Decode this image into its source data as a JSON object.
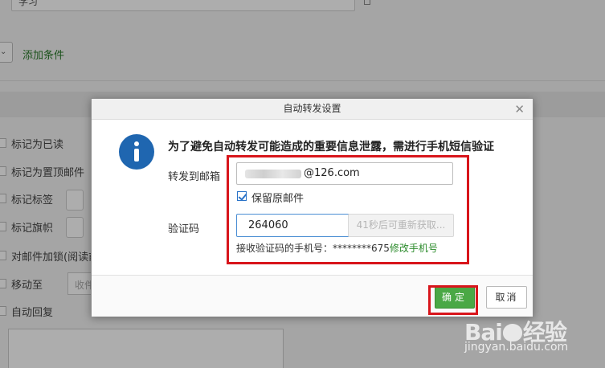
{
  "background": {
    "top_input_value": "学习",
    "add_condition": "添加条件",
    "actions": [
      {
        "label": "标记为已读"
      },
      {
        "label": "标记为置顶邮件"
      },
      {
        "label": "标记标签"
      },
      {
        "label": "标记旗帜"
      },
      {
        "label": "对邮件加锁(阅读前"
      },
      {
        "label": "移动至"
      },
      {
        "label": "自动回复"
      }
    ],
    "move_to_placeholder": "收件箱"
  },
  "dialog": {
    "title": "自动转发设置",
    "close_glyph": "✕",
    "notice": "为了避免自动转发可能造成的重要信息泄露，需进行手机短信验证",
    "forward_label": "转发到邮箱",
    "email_value": "@126.com",
    "keep_original_label": "保留原邮件",
    "keep_original_checked": true,
    "code_label": "验证码",
    "code_value": "264060",
    "resend_label": "41秒后可重新获取...",
    "phone_prefix": "接收验证码的手机号：********675",
    "change_phone_link": "修改手机号",
    "ok_label": "确定",
    "cancel_label": "取消"
  },
  "watermark": {
    "logo_left": "Bai",
    "logo_right": "经验",
    "url": "jingyan.baidu.com"
  },
  "colors": {
    "accent_green": "#4aa845",
    "info_blue": "#1f66b0",
    "highlight_red": "#d8151b",
    "link_green": "#2a8a2a"
  }
}
